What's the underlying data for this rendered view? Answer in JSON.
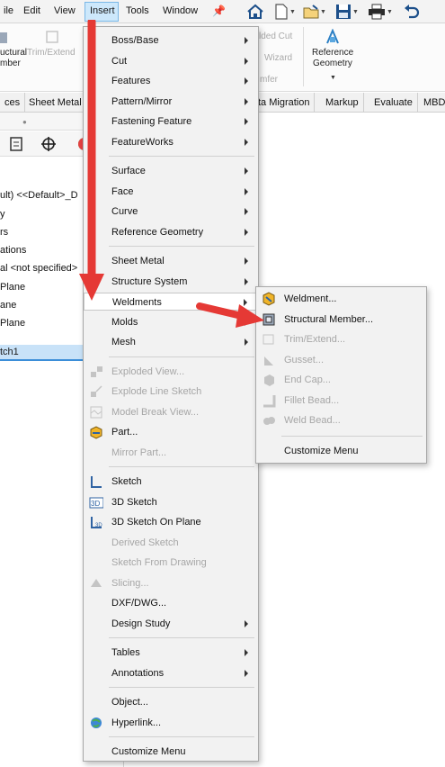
{
  "menubar": {
    "items": [
      "ile",
      "Edit",
      "View",
      "Insert",
      "Tools",
      "Window"
    ]
  },
  "ribbon": {
    "structural_line1": "uctural",
    "structural_line2": "mber",
    "trim_extend": "Trim/Extend",
    "welded_cut": "lded Cut",
    "wizard": "Wizard",
    "chamfer": "mfer",
    "ref_geom_line1": "Reference",
    "ref_geom_line2": "Geometry"
  },
  "tabs": [
    "ces",
    "Sheet Metal",
    "ta Migration",
    "Markup",
    "Evaluate",
    "MBD"
  ],
  "tree": {
    "items": [
      "ult) <<Default>_D",
      "y",
      "rs",
      "ations",
      "al <not specified>",
      "Plane",
      "ane",
      "Plane"
    ],
    "selected": "tch1"
  },
  "insert_menu": {
    "groups": [
      [
        {
          "label": "Boss/Base",
          "sub": true
        },
        {
          "label": "Cut",
          "sub": true
        },
        {
          "label": "Features",
          "sub": true
        },
        {
          "label": "Pattern/Mirror",
          "sub": true
        },
        {
          "label": "Fastening Feature",
          "sub": true
        },
        {
          "label": "FeatureWorks",
          "sub": true
        }
      ],
      [
        {
          "label": "Surface",
          "sub": true
        },
        {
          "label": "Face",
          "sub": true
        },
        {
          "label": "Curve",
          "sub": true
        },
        {
          "label": "Reference Geometry",
          "sub": true
        }
      ],
      [
        {
          "label": "Sheet Metal",
          "sub": true
        },
        {
          "label": "Structure System",
          "sub": true
        },
        {
          "label": "Weldments",
          "sub": true,
          "highlighted": true
        },
        {
          "label": "Molds",
          "sub": true
        },
        {
          "label": "Mesh",
          "sub": true
        }
      ],
      [
        {
          "label": "Exploded View...",
          "disabled": true,
          "icon": "exploded-view-icon"
        },
        {
          "label": "Explode Line Sketch",
          "disabled": true,
          "icon": "explode-line-sketch-icon"
        },
        {
          "label": "Model Break View...",
          "disabled": true,
          "icon": "model-break-view-icon"
        },
        {
          "label": "Part...",
          "icon": "part-icon"
        },
        {
          "label": "Mirror Part...",
          "disabled": true
        }
      ],
      [
        {
          "label": "Sketch",
          "icon": "sketch-icon"
        },
        {
          "label": "3D Sketch",
          "icon": "3d-sketch-icon"
        },
        {
          "label": "3D Sketch On Plane",
          "icon": "3d-sketch-on-plane-icon"
        },
        {
          "label": "Derived Sketch",
          "disabled": true
        },
        {
          "label": "Sketch From Drawing",
          "disabled": true
        },
        {
          "label": "Slicing...",
          "disabled": true,
          "icon": "slicing-icon"
        },
        {
          "label": "DXF/DWG..."
        },
        {
          "label": "Design Study",
          "sub": true
        }
      ],
      [
        {
          "label": "Tables",
          "sub": true
        },
        {
          "label": "Annotations",
          "sub": true
        }
      ],
      [
        {
          "label": "Object..."
        },
        {
          "label": "Hyperlink...",
          "icon": "hyperlink-globe-icon"
        }
      ],
      [
        {
          "label": "Customize Menu"
        }
      ]
    ]
  },
  "weldments_menu": {
    "items": [
      {
        "label": "Weldment...",
        "icon": "weldment-icon"
      },
      {
        "label": "Structural Member...",
        "icon": "structural-member-icon"
      },
      {
        "label": "Trim/Extend...",
        "disabled": true,
        "icon": "trim-extend-icon"
      },
      {
        "label": "Gusset...",
        "disabled": true,
        "icon": "gusset-icon"
      },
      {
        "label": "End Cap...",
        "disabled": true,
        "icon": "end-cap-icon"
      },
      {
        "label": "Fillet Bead...",
        "disabled": true,
        "icon": "fillet-bead-icon"
      },
      {
        "label": "Weld Bead...",
        "disabled": true,
        "icon": "weld-bead-icon"
      }
    ],
    "customize": "Customize Menu"
  },
  "colors": {
    "annotation_arrow": "#e53935",
    "menu_bg": "#f2f2f2",
    "insert_highlight": "#cde8fb"
  }
}
